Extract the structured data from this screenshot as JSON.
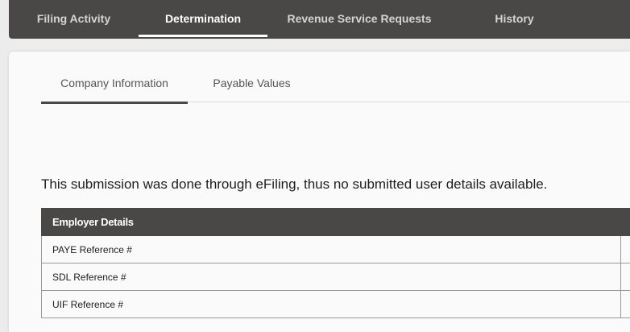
{
  "top_tabs": [
    {
      "label": "Filing Activity",
      "active": false
    },
    {
      "label": "Determination",
      "active": true
    },
    {
      "label": "Revenue Service Requests",
      "active": false
    },
    {
      "label": "History",
      "active": false
    }
  ],
  "sub_tabs": [
    {
      "label": "Company Information",
      "active": true
    },
    {
      "label": "Payable Values",
      "active": false
    }
  ],
  "notice": "This submission was done through eFiling, thus no submitted user details available.",
  "employer_table": {
    "header": "Employer Details",
    "rows": [
      {
        "label": "PAYE Reference #",
        "value": ""
      },
      {
        "label": "SDL Reference #",
        "value": ""
      },
      {
        "label": "UIF Reference #",
        "value": ""
      }
    ]
  },
  "colors": {
    "nav_bg": "#4a4846",
    "accent": "#4a4846",
    "page_bg": "#ececec",
    "card_bg": "#fafafa"
  }
}
